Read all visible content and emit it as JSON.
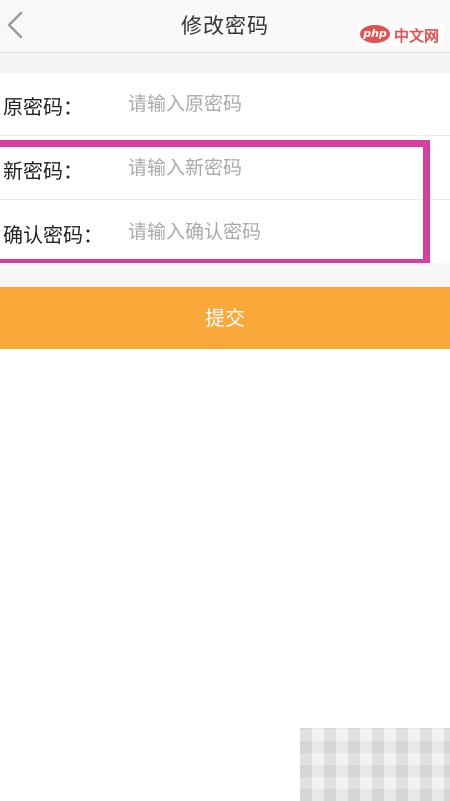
{
  "header": {
    "title": "修改密码",
    "back_icon": "chevron-left-icon"
  },
  "watermark": {
    "logo": "php",
    "text": "中文网"
  },
  "form": {
    "fields": [
      {
        "label": "原密码：",
        "placeholder": "请输入原密码",
        "value": ""
      },
      {
        "label": "新密码：",
        "placeholder": "请输入新密码",
        "value": ""
      },
      {
        "label": "确认密码：",
        "placeholder": "请输入确认密码",
        "value": ""
      }
    ]
  },
  "submit": {
    "label": "提交"
  },
  "colors": {
    "accent": "#f8a93a",
    "highlight": "#d63f9e",
    "watermark": "#e5504e"
  }
}
